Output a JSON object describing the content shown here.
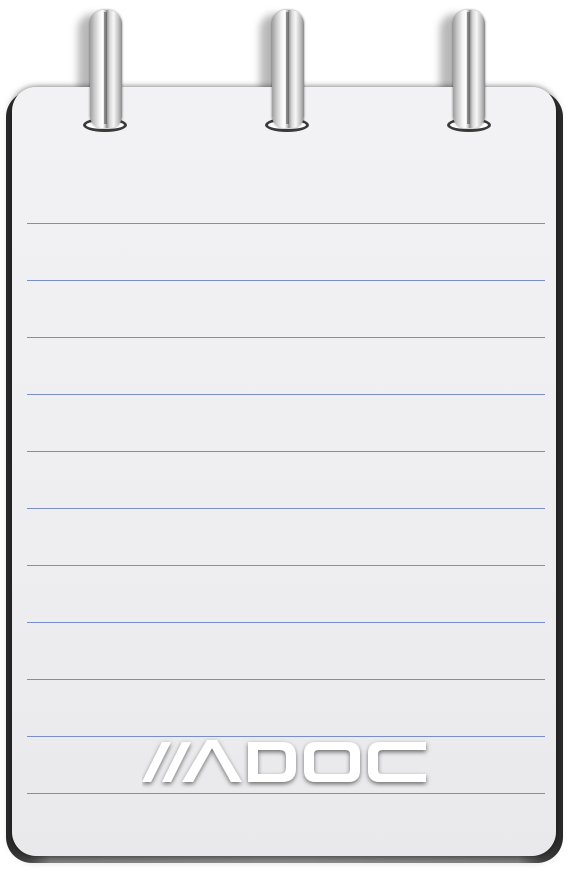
{
  "logo": {
    "text": "//ADOC",
    "color": "#ffffff"
  },
  "notepad": {
    "paper_color": "#efeff1",
    "rule_color": "#7b8dc8",
    "ruled_line_count": 11,
    "ring_count": 3
  }
}
